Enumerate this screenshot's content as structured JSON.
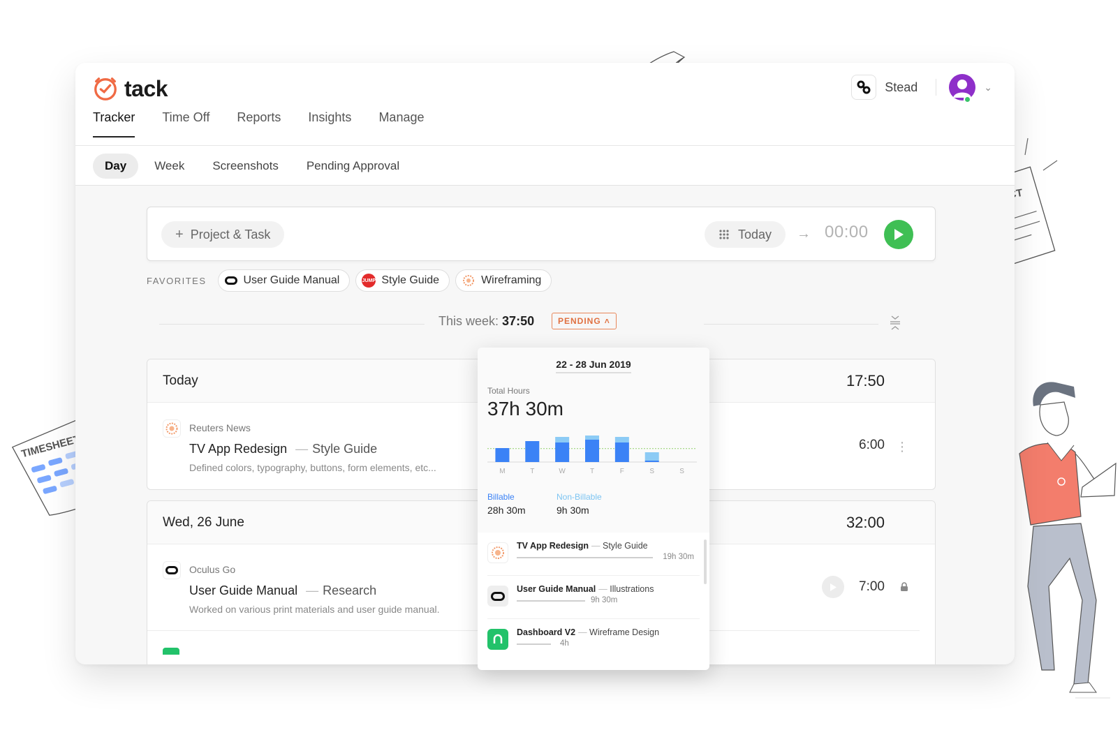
{
  "app": {
    "name": "tack",
    "main_tabs": [
      "Tracker",
      "Time Off",
      "Reports",
      "Insights",
      "Manage"
    ],
    "sub_tabs": [
      "Day",
      "Week",
      "Screenshots",
      "Pending Approval"
    ],
    "org_name": "Stead"
  },
  "timer": {
    "project_button": "Project & Task",
    "date_button": "Today",
    "time": "00:00"
  },
  "favorites": {
    "label": "FAVORITES",
    "items": [
      "User Guide Manual",
      "Style Guide",
      "Wireframing"
    ],
    "jump_badge": "JUMP"
  },
  "week": {
    "label": "This week:",
    "total": "37:50",
    "status": "PENDING"
  },
  "days": [
    {
      "title": "Today",
      "total": "17:50",
      "entry": {
        "client": "Reuters News",
        "project": "TV App Redesign",
        "task": "Style Guide",
        "description": "Defined colors, typography, buttons, form elements, etc...",
        "duration": "6:00"
      }
    },
    {
      "title": "Wed, 26 June",
      "total": "32:00",
      "entry": {
        "client": "Oculus Go",
        "project": "User Guide Manual",
        "task": "Research",
        "description": "Worked on various print materials and user guide manual.",
        "duration": "7:00"
      }
    }
  ],
  "popover": {
    "range": "22 - 28 Jun 2019",
    "total_label": "Total Hours",
    "total": "37h 30m",
    "billable_label": "Billable",
    "billable": "28h 30m",
    "nonbillable_label": "Non-Billable",
    "nonbillable": "9h 30m",
    "items": [
      {
        "project": "TV App Redesign",
        "task": "Style Guide",
        "hours": "19h 30m",
        "share": 1.0
      },
      {
        "project": "User Guide Manual",
        "task": "Illustrations",
        "hours": "9h 30m",
        "share": 0.5
      },
      {
        "project": "Dashboard V2",
        "task": "Wireframe Design",
        "hours": "4h",
        "share": 0.25
      }
    ]
  },
  "decorations": {
    "timesheet_label": "TIMESHEET",
    "project_label": "PROJECT"
  },
  "chart_data": {
    "type": "bar",
    "categories": [
      "M",
      "T",
      "W",
      "T",
      "F",
      "S",
      "S"
    ],
    "series": [
      {
        "name": "Billable",
        "values": [
          5,
          7.5,
          7,
          8,
          7,
          0.5,
          0
        ]
      },
      {
        "name": "Non-Billable",
        "values": [
          0,
          0,
          2,
          1.5,
          2,
          3,
          0
        ]
      }
    ],
    "target_line": 8,
    "ylim": [
      0,
      14
    ]
  },
  "colors": {
    "brand": "#f06a44",
    "billable": "#3b82f6",
    "nonbillable": "#8ccbf5",
    "play": "#3fbf54",
    "pending": "#e07040"
  }
}
